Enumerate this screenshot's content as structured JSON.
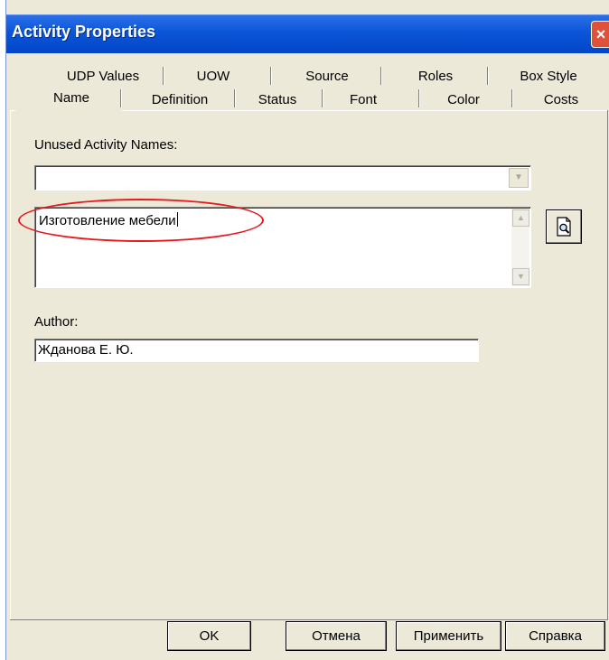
{
  "window": {
    "title": "Activity Properties",
    "close_glyph": "×"
  },
  "tabs": {
    "row1": [
      "UDP Values",
      "UOW",
      "Source",
      "Roles",
      "Box Style"
    ],
    "row2": [
      "Name",
      "Definition",
      "Status",
      "Font",
      "Color",
      "Costs"
    ],
    "active": "Name"
  },
  "form": {
    "unused_names_label": "Unused Activity Names:",
    "unused_names_value": "",
    "activity_name_value": "Изготовление мебели",
    "author_label": "Author:",
    "author_value": "Жданова Е. Ю."
  },
  "buttons": {
    "ok": "OK",
    "cancel": "Отмена",
    "apply": "Применить",
    "help": "Справка"
  },
  "icons": {
    "dropdown": "chevron-down-icon",
    "scroll_up": "scroll-up-icon",
    "scroll_down": "scroll-down-icon",
    "zoom": "document-magnifier-icon",
    "close": "close-icon"
  },
  "colors": {
    "titlebar": "#0a55d8",
    "dialog_bg": "#ece9d8",
    "annotation": "#e8191e",
    "close_button": "#e0513a"
  }
}
